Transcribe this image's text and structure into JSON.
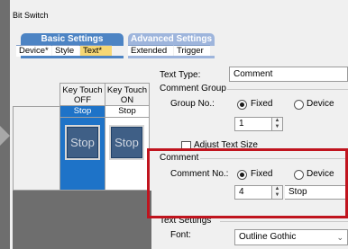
{
  "window": {
    "title": "Bit Switch"
  },
  "tabs": {
    "basic": "Basic Settings",
    "advanced": "Advanced Settings",
    "sub": [
      {
        "label": "Device*",
        "active": false
      },
      {
        "label": "Style",
        "active": false
      },
      {
        "label": "Text*",
        "active": true
      },
      {
        "label": "Extended",
        "active": false
      },
      {
        "label": "Trigger",
        "active": false
      }
    ]
  },
  "preview": {
    "col_off": "Key Touch\nOFF",
    "col_on": "Key Touch\nON",
    "text_off": "Stop",
    "text_on": "Stop",
    "btn_off": "Stop",
    "btn_on": "Stop"
  },
  "settings": {
    "text_type_label": "Text Type:",
    "text_type_value": "Comment",
    "comment_group_title": "Comment Group",
    "group_no_label": "Group No.:",
    "fixed_label": "Fixed",
    "device_label": "Device",
    "group_no_value": "1",
    "adjust_text_size": "Adjust Text Size",
    "comment_title": "Comment",
    "comment_no_label": "Comment No.:",
    "comment_fixed_label": "Fixed",
    "comment_device_label": "Device",
    "comment_no_value": "4",
    "comment_text": "Stop",
    "text_settings_title": "Text Settings",
    "font_label": "Font:",
    "font_value": "Outline Gothic"
  },
  "colors": {
    "basic_tab": "#4d84c4",
    "advanced_tab": "#9eb5dc",
    "active_subtab": "#f6d774",
    "highlight": "#c0141e",
    "button": "#3f5f86"
  }
}
